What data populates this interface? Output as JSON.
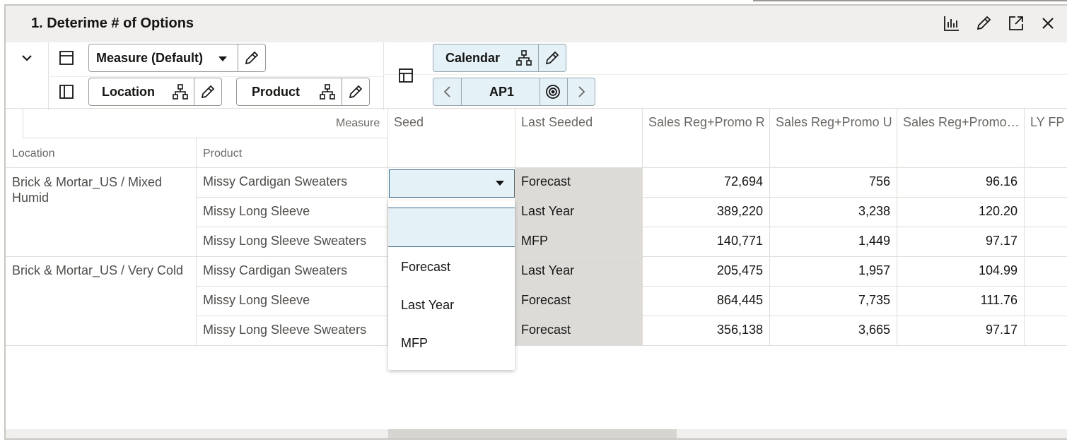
{
  "window": {
    "title": "1. Deterime # of Options",
    "actions": [
      "chart-icon",
      "edit-icon",
      "expand-icon",
      "close-icon"
    ]
  },
  "toolbar": {
    "measure_label": "Measure (Default)",
    "location_label": "Location",
    "product_label": "Product",
    "calendar_label": "Calendar",
    "period_label": "AP1"
  },
  "grid": {
    "measure_header": "Measure",
    "location_header": "Location",
    "product_header": "Product",
    "columns": [
      "Seed",
      "Last Seeded",
      "Sales Reg+Promo R",
      "Sales Reg+Promo U",
      "Sales Reg+Promo…",
      "LY FP"
    ],
    "rows": [
      {
        "location": "Brick & Mortar_US / Mixed Humid",
        "product": "Missy Cardigan Sweaters",
        "last_seeded": "Forecast",
        "r": "72,694",
        "u": "756",
        "p": "96.16"
      },
      {
        "location": "",
        "product": "Missy Long Sleeve",
        "last_seeded": "Last Year",
        "r": "389,220",
        "u": "3,238",
        "p": "120.20"
      },
      {
        "location": "",
        "product": "Missy Long Sleeve Sweaters",
        "last_seeded": "MFP",
        "r": "140,771",
        "u": "1,449",
        "p": "97.17"
      },
      {
        "location": "Brick & Mortar_US / Very Cold",
        "product": "Missy Cardigan Sweaters",
        "last_seeded": "Last Year",
        "r": "205,475",
        "u": "1,957",
        "p": "104.99"
      },
      {
        "location": "",
        "product": "Missy Long Sleeve",
        "last_seeded": "Forecast",
        "r": "864,445",
        "u": "7,735",
        "p": "111.76"
      },
      {
        "location": "",
        "product": "Missy Long Sleeve Sweaters",
        "last_seeded": "Forecast",
        "r": "356,138",
        "u": "3,665",
        "p": "97.17"
      }
    ]
  },
  "dropdown": {
    "selected": "",
    "options": [
      "Forecast",
      "Last Year",
      "MFP"
    ]
  },
  "colors": {
    "accent": "#3b6e8f",
    "selected_bg": "#e4f1f7",
    "readonly_bg": "#dddbd8"
  }
}
